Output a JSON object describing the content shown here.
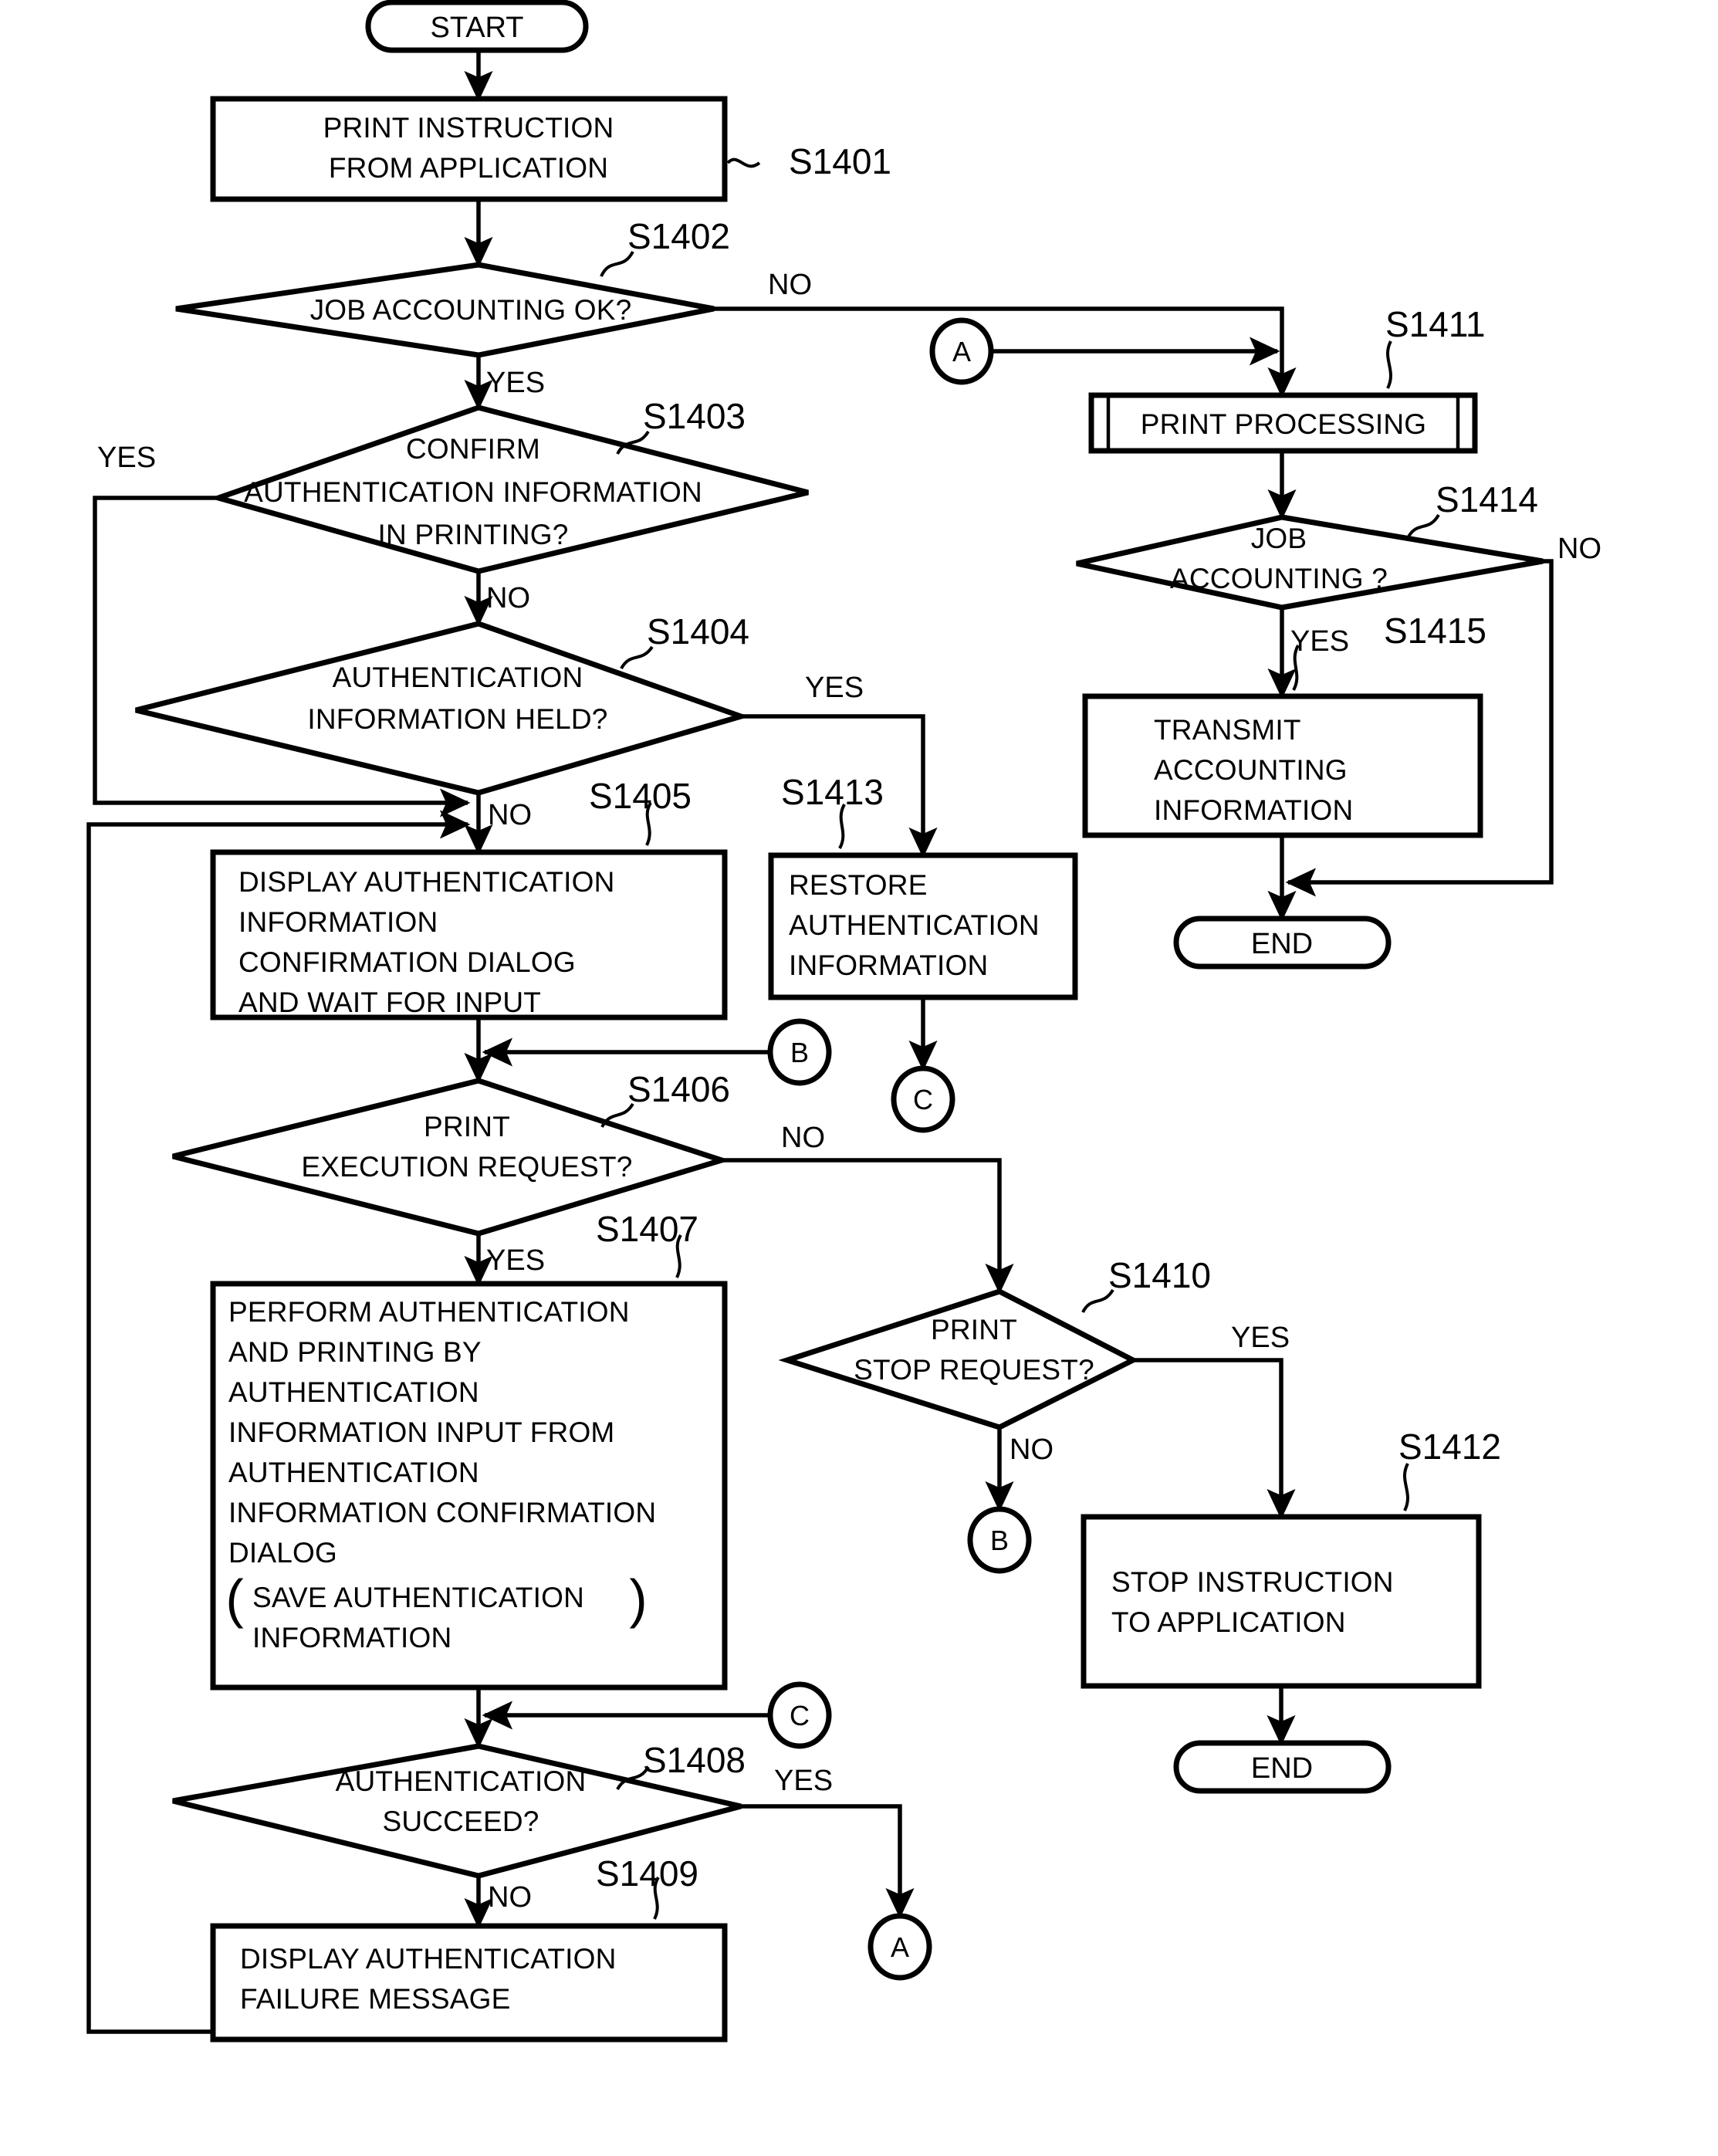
{
  "diagram": {
    "type": "flowchart",
    "title": "",
    "terminators": {
      "start": "START",
      "end_right": "END",
      "end_bottom": "END"
    },
    "connectors": {
      "a_top": "A",
      "a_bottom": "A",
      "b_mid": "B",
      "b_bottom": "B",
      "c_mid": "C",
      "c_bottom": "C"
    },
    "steps": [
      {
        "id": "S1401",
        "label": "S1401",
        "shape": "process",
        "text_lines": [
          "PRINT INSTRUCTION",
          "FROM APPLICATION"
        ]
      },
      {
        "id": "S1402",
        "label": "S1402",
        "shape": "decision",
        "text_lines": [
          "JOB ACCOUNTING OK?"
        ],
        "branches": {
          "yes": "YES",
          "no": "NO"
        }
      },
      {
        "id": "S1403",
        "label": "S1403",
        "shape": "decision",
        "text_lines": [
          "CONFIRM",
          "AUTHENTICATION INFORMATION",
          "IN PRINTING?"
        ],
        "branches": {
          "yes": "YES",
          "no": "NO"
        }
      },
      {
        "id": "S1404",
        "label": "S1404",
        "shape": "decision",
        "text_lines": [
          "AUTHENTICATION",
          "INFORMATION HELD?"
        ],
        "branches": {
          "yes": "YES",
          "no": "NO"
        }
      },
      {
        "id": "S1405",
        "label": "S1405",
        "shape": "process",
        "text_lines": [
          "DISPLAY AUTHENTICATION",
          "INFORMATION",
          "CONFIRMATION DIALOG",
          "AND WAIT FOR INPUT"
        ]
      },
      {
        "id": "S1406",
        "label": "S1406",
        "shape": "decision",
        "text_lines": [
          "PRINT",
          "EXECUTION REQUEST?"
        ],
        "branches": {
          "yes": "YES",
          "no": "NO"
        }
      },
      {
        "id": "S1407",
        "label": "S1407",
        "shape": "process",
        "text_lines": [
          "PERFORM AUTHENTICATION",
          "AND PRINTING BY",
          "AUTHENTICATION",
          "INFORMATION INPUT FROM",
          "AUTHENTICATION",
          "INFORMATION CONFIRMATION",
          "DIALOG"
        ],
        "paren_lines": [
          "SAVE AUTHENTICATION",
          "INFORMATION"
        ]
      },
      {
        "id": "S1408",
        "label": "S1408",
        "shape": "decision",
        "text_lines": [
          "AUTHENTICATION",
          "SUCCEED?"
        ],
        "branches": {
          "yes": "YES",
          "no": "NO"
        }
      },
      {
        "id": "S1409",
        "label": "S1409",
        "shape": "process",
        "text_lines": [
          "DISPLAY AUTHENTICATION",
          "FAILURE MESSAGE"
        ]
      },
      {
        "id": "S1410",
        "label": "S1410",
        "shape": "decision",
        "text_lines": [
          "PRINT",
          "STOP REQUEST?"
        ],
        "branches": {
          "yes": "YES",
          "no": "NO"
        }
      },
      {
        "id": "S1411",
        "label": "S1411",
        "shape": "predefined-process",
        "text_lines": [
          "PRINT PROCESSING"
        ]
      },
      {
        "id": "S1412",
        "label": "S1412",
        "shape": "process",
        "text_lines": [
          "STOP INSTRUCTION",
          "TO APPLICATION"
        ]
      },
      {
        "id": "S1413",
        "label": "S1413",
        "shape": "process",
        "text_lines": [
          "RESTORE",
          "AUTHENTICATION",
          "INFORMATION"
        ]
      },
      {
        "id": "S1414",
        "label": "S1414",
        "shape": "decision",
        "text_lines": [
          "JOB",
          "ACCOUNTING  ?"
        ],
        "branches": {
          "yes": "YES",
          "no": "NO"
        }
      },
      {
        "id": "S1415",
        "label": "S1415",
        "shape": "process",
        "text_lines": [
          "TRANSMIT",
          "ACCOUNTING",
          "INFORMATION"
        ]
      }
    ],
    "branch_labels": {
      "s1402_no": "NO",
      "s1402_yes": "YES",
      "s1403_yes": "YES",
      "s1403_no": "NO",
      "s1404_yes": "YES",
      "s1404_no": "NO",
      "s1406_no": "NO",
      "s1406_yes": "YES",
      "s1408_yes": "YES",
      "s1408_no": "NO",
      "s1410_yes": "YES",
      "s1410_no": "NO",
      "s1414_no": "NO",
      "s1414_yes": "YES"
    },
    "paren_open": "(",
    "paren_close": ")",
    "colors": {
      "stroke": "#000000",
      "fill": "#ffffff",
      "background": "#ffffff"
    }
  }
}
